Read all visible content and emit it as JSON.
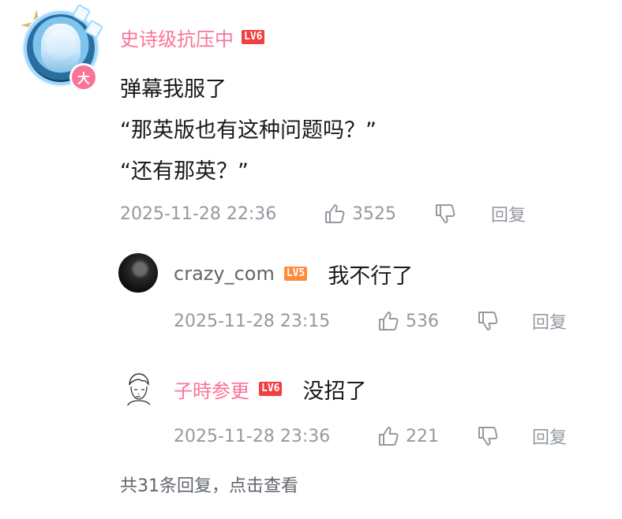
{
  "main_comment": {
    "username": "史诗级抗压中",
    "level": "LV6",
    "badge_char": "大",
    "content_lines": [
      "弹幕我服了",
      "“那英版也有这种问题吗？”",
      "“还有那英？”"
    ],
    "timestamp": "2025-11-28 22:36",
    "like_count": "3525",
    "reply_label": "回复"
  },
  "replies": [
    {
      "username": "crazy_com",
      "level": "LV5",
      "content": "我不行了",
      "timestamp": "2025-11-28 23:15",
      "like_count": "536",
      "reply_label": "回复"
    },
    {
      "username": "子時参更",
      "level": "LV6",
      "content": "没招了",
      "timestamp": "2025-11-28 23:36",
      "like_count": "221",
      "reply_label": "回复"
    }
  ],
  "more_replies_text": "共31条回复，点击查看",
  "colors": {
    "vip_pink": "#fb7299",
    "lv6": "#f23f3f",
    "lv5": "#ff8c3b",
    "meta_gray": "#9499a0",
    "text": "#18191c"
  }
}
